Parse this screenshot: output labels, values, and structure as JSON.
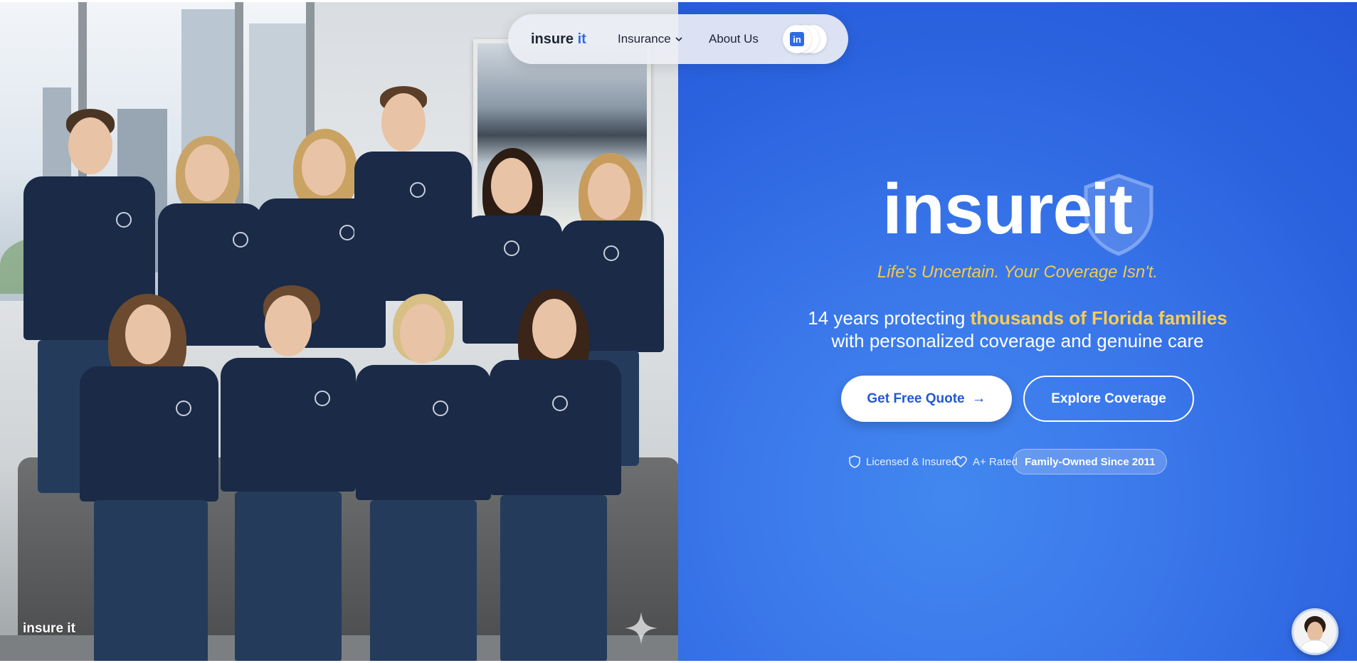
{
  "nav": {
    "brand_insure": "insure",
    "brand_it": "it",
    "insurance_label": "Insurance",
    "about_label": "About Us",
    "social_icons": [
      "linkedin-icon",
      "social-icon",
      "social-icon"
    ]
  },
  "photo": {
    "watermark": "insure it",
    "icon": "sparkle-icon"
  },
  "hero": {
    "logo_insure": "insure",
    "logo_it": "it",
    "tagline": "Life's Uncertain. Your Coverage Isn't.",
    "desc_prefix": "14 years protecting ",
    "desc_highlight": "thousands of Florida families",
    "desc_line2": "with personalized coverage and genuine care",
    "cta_primary": "Get Free Quote",
    "cta_primary_icon": "arrow-right-icon",
    "cta_secondary": "Explore Coverage",
    "badge_licensed": "Licensed & Insured",
    "badge_rated": "A+ Rated",
    "badge_family": "Family-Owned Since 2011"
  },
  "colors": {
    "hero_blue": "#2b63df",
    "accent_yellow": "#f5c84f",
    "navy_shirt": "#1a2a47"
  }
}
